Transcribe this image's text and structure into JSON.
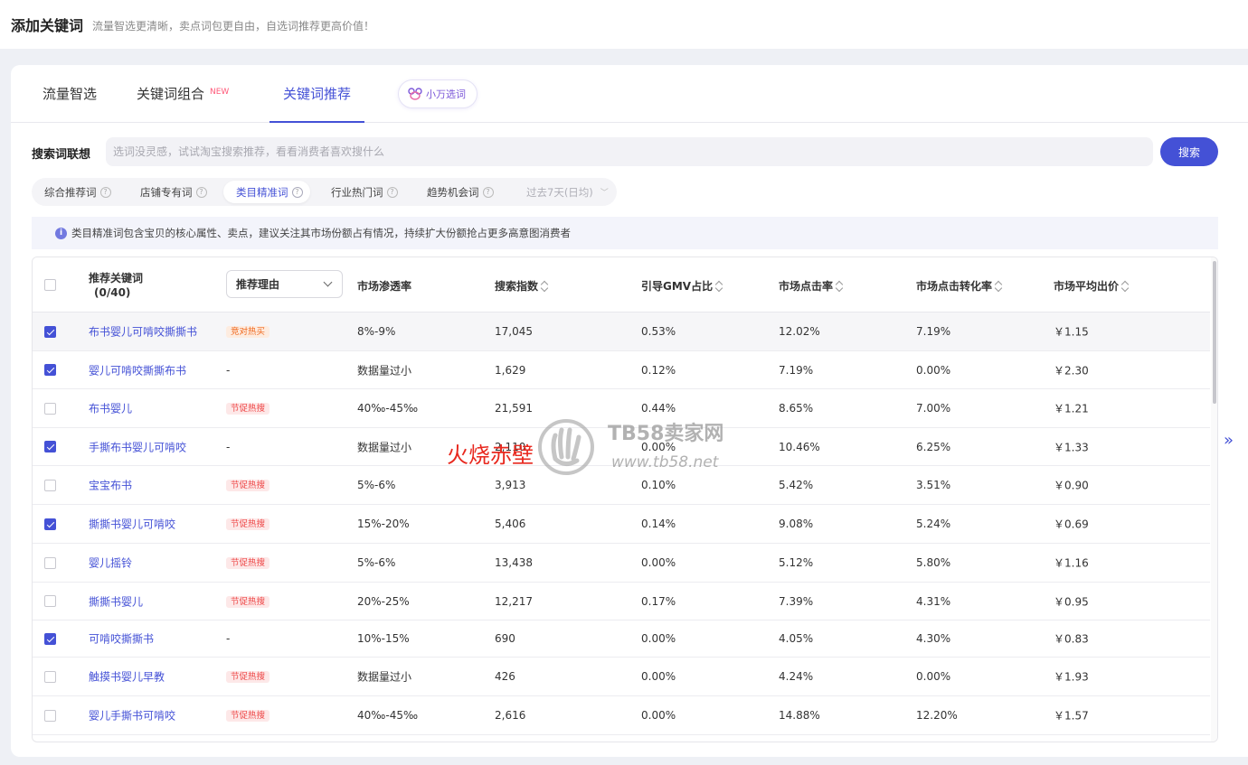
{
  "header": {
    "title": "添加关键词",
    "subtitle": "流量智选更清晰，卖点词包更自由，自选词推荐更高价值！"
  },
  "tabs": [
    {
      "label": "流量智选"
    },
    {
      "label": "关键词组合",
      "badge": "NEW"
    },
    {
      "label": "关键词推荐",
      "active": true
    }
  ],
  "xiaowan": {
    "label": "小万选词"
  },
  "search": {
    "label": "搜索词联想",
    "placeholder": "选词没灵感，试试淘宝搜索推荐，看看消费者喜欢搜什么",
    "button": "搜索"
  },
  "subtabs": [
    {
      "label": "综合推荐词"
    },
    {
      "label": "店铺专有词"
    },
    {
      "label": "类目精准词",
      "active": true
    },
    {
      "label": "行业热门词"
    },
    {
      "label": "趋势机会词"
    }
  ],
  "period": {
    "label": "过去7天(日均)"
  },
  "notice": {
    "text": "类目精准词包含宝贝的核心属性、卖点，建议关注其市场份额占有情况，持续扩大份额抢占更多高意图消费者"
  },
  "table": {
    "headers": {
      "keyword": "推荐关键词",
      "keyword_count": "(0/40)",
      "reason": "推荐理由",
      "penetration": "市场渗透率",
      "search_index": "搜索指数",
      "gmv_ratio": "引导GMV占比",
      "ctr": "市场点击率",
      "cvr": "市场点击转化率",
      "avg_bid": "市场平均出价"
    },
    "rows": [
      {
        "checked": true,
        "keyword": "布书婴儿可啃咬撕撕书",
        "reason": "竞对热买",
        "reason_color": "orange",
        "penetration": "8%-9%",
        "search_index": "17,045",
        "gmv_ratio": "0.53%",
        "ctr": "12.02%",
        "cvr": "7.19%",
        "avg_bid": "￥1.15"
      },
      {
        "checked": true,
        "keyword": "婴儿可啃咬撕撕布书",
        "reason": "-",
        "reason_color": "",
        "penetration": "数据量过小",
        "search_index": "1,629",
        "gmv_ratio": "0.12%",
        "ctr": "7.19%",
        "cvr": "0.00%",
        "avg_bid": "￥2.30"
      },
      {
        "checked": false,
        "keyword": "布书婴儿",
        "reason": "节促热搜",
        "reason_color": "red",
        "penetration": "40‰-45‰",
        "search_index": "21,591",
        "gmv_ratio": "0.44%",
        "ctr": "8.65%",
        "cvr": "7.00%",
        "avg_bid": "￥1.21"
      },
      {
        "checked": true,
        "keyword": "手撕布书婴儿可啃咬",
        "reason": "-",
        "reason_color": "",
        "penetration": "数据量过小",
        "search_index": "2,110",
        "gmv_ratio": "0.00%",
        "ctr": "10.46%",
        "cvr": "6.25%",
        "avg_bid": "￥1.33"
      },
      {
        "checked": false,
        "keyword": "宝宝布书",
        "reason": "节促热搜",
        "reason_color": "red",
        "penetration": "5%-6%",
        "search_index": "3,913",
        "gmv_ratio": "0.10%",
        "ctr": "5.42%",
        "cvr": "3.51%",
        "avg_bid": "￥0.90"
      },
      {
        "checked": true,
        "keyword": "撕撕书婴儿可啃咬",
        "reason": "节促热搜",
        "reason_color": "red",
        "penetration": "15%-20%",
        "search_index": "5,406",
        "gmv_ratio": "0.14%",
        "ctr": "9.08%",
        "cvr": "5.24%",
        "avg_bid": "￥0.69"
      },
      {
        "checked": false,
        "keyword": "婴儿摇铃",
        "reason": "节促热搜",
        "reason_color": "red",
        "penetration": "5%-6%",
        "search_index": "13,438",
        "gmv_ratio": "0.00%",
        "ctr": "5.12%",
        "cvr": "5.80%",
        "avg_bid": "￥1.16"
      },
      {
        "checked": false,
        "keyword": "撕撕书婴儿",
        "reason": "节促热搜",
        "reason_color": "red",
        "penetration": "20%-25%",
        "search_index": "12,217",
        "gmv_ratio": "0.17%",
        "ctr": "7.39%",
        "cvr": "4.31%",
        "avg_bid": "￥0.95"
      },
      {
        "checked": true,
        "keyword": "可啃咬撕撕书",
        "reason": "-",
        "reason_color": "",
        "penetration": "10%-15%",
        "search_index": "690",
        "gmv_ratio": "0.00%",
        "ctr": "4.05%",
        "cvr": "4.30%",
        "avg_bid": "￥0.83"
      },
      {
        "checked": false,
        "keyword": "触摸书婴儿早教",
        "reason": "节促热搜",
        "reason_color": "red",
        "penetration": "数据量过小",
        "search_index": "426",
        "gmv_ratio": "0.00%",
        "ctr": "4.24%",
        "cvr": "0.00%",
        "avg_bid": "￥1.93"
      },
      {
        "checked": false,
        "keyword": "婴儿手撕书可啃咬",
        "reason": "节促热搜",
        "reason_color": "red",
        "penetration": "40‰-45‰",
        "search_index": "2,616",
        "gmv_ratio": "0.00%",
        "ctr": "14.88%",
        "cvr": "12.20%",
        "avg_bid": "￥1.57"
      }
    ]
  },
  "watermark": {
    "title": "TB58卖家网",
    "url": "www.tb58.net"
  },
  "overlay_text": "火烧赤壁",
  "colors": {
    "accent": "#4451d6",
    "tag_red": "#ee4a4a",
    "tag_orange": "#f06b22",
    "overlay_red": "#e8281e"
  }
}
